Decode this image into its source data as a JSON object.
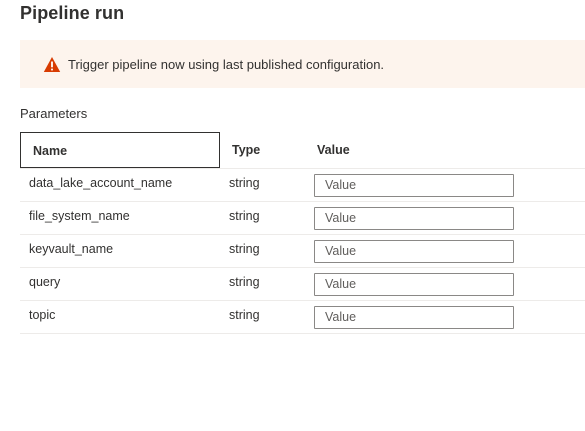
{
  "title": "Pipeline run",
  "banner": {
    "icon": "warning-icon",
    "icon_color": "#d83b01",
    "background": "#fdf4ed",
    "message": "Trigger pipeline now using last published configuration."
  },
  "parameters": {
    "label": "Parameters",
    "columns": {
      "name": "Name",
      "type": "Type",
      "value": "Value"
    },
    "rows": [
      {
        "name": "data_lake_account_name",
        "type": "string",
        "value": "",
        "placeholder": "Value"
      },
      {
        "name": "file_system_name",
        "type": "string",
        "value": "",
        "placeholder": "Value"
      },
      {
        "name": "keyvault_name",
        "type": "string",
        "value": "",
        "placeholder": "Value"
      },
      {
        "name": "query",
        "type": "string",
        "value": "",
        "placeholder": "Value"
      },
      {
        "name": "topic",
        "type": "string",
        "value": "",
        "placeholder": "Value"
      }
    ]
  }
}
